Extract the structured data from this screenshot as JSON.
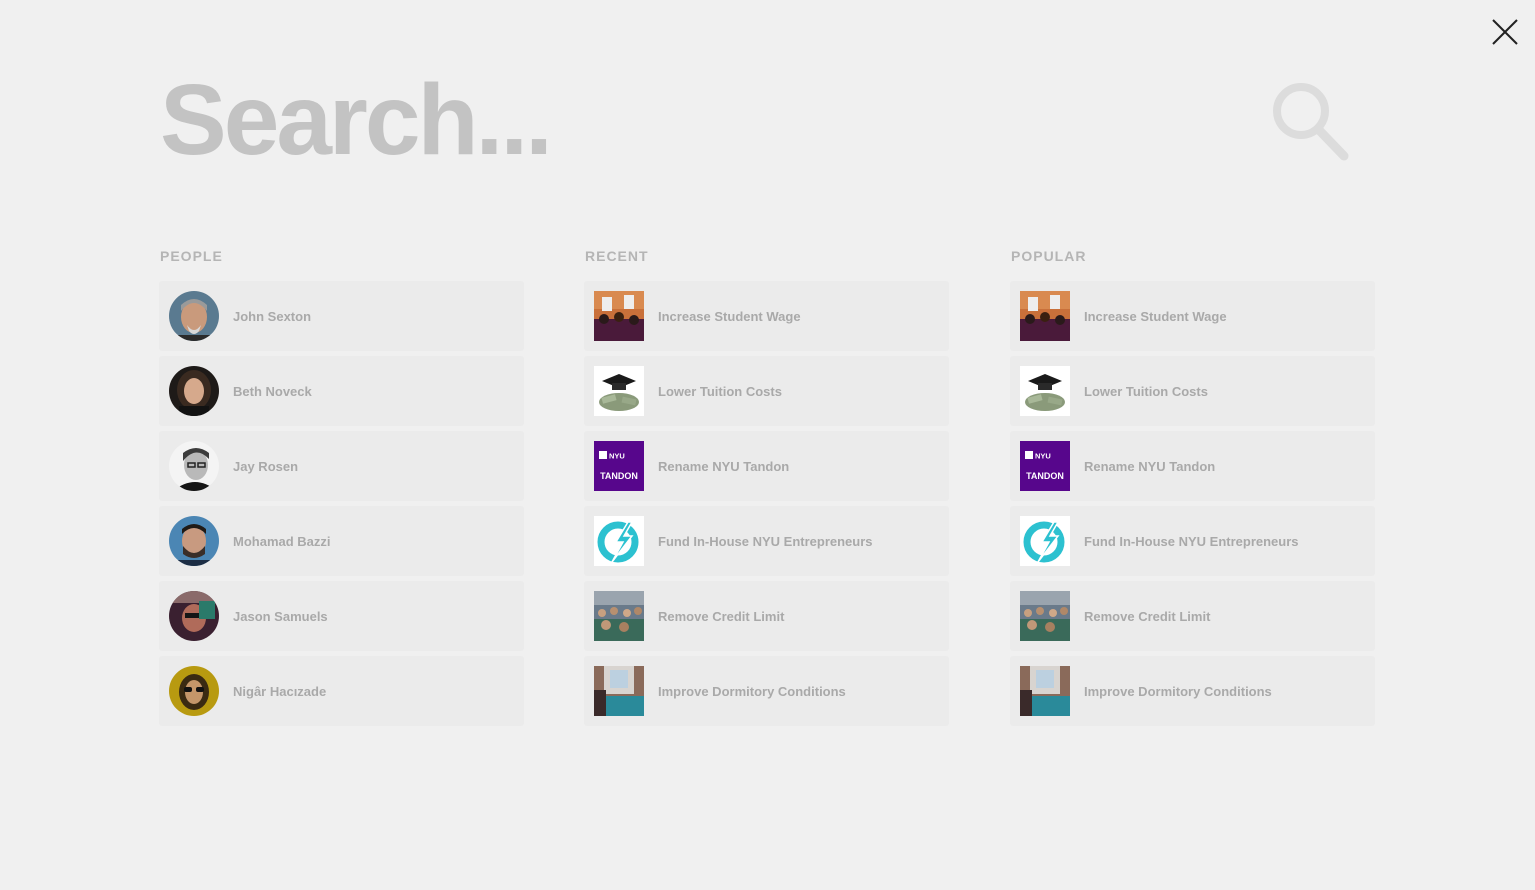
{
  "search": {
    "placeholder": "Search..."
  },
  "sections": {
    "people": {
      "title": "PEOPLE",
      "items": [
        {
          "name": "John Sexton"
        },
        {
          "name": "Beth Noveck"
        },
        {
          "name": "Jay Rosen"
        },
        {
          "name": "Mohamad Bazzi"
        },
        {
          "name": "Jason Samuels"
        },
        {
          "name": "Nigâr Hacızade"
        }
      ]
    },
    "recent": {
      "title": "RECENT",
      "items": [
        {
          "label": "Increase Student Wage"
        },
        {
          "label": "Lower Tuition Costs"
        },
        {
          "label": "Rename NYU Tandon"
        },
        {
          "label": "Fund In-House NYU Entrepreneurs"
        },
        {
          "label": "Remove Credit Limit"
        },
        {
          "label": "Improve Dormitory Conditions"
        }
      ]
    },
    "popular": {
      "title": "POPULAR",
      "items": [
        {
          "label": "Increase Student Wage"
        },
        {
          "label": "Lower Tuition Costs"
        },
        {
          "label": "Rename NYU Tandon"
        },
        {
          "label": "Fund In-House NYU Entrepreneurs"
        },
        {
          "label": "Remove Credit Limit"
        },
        {
          "label": "Improve Dormitory Conditions"
        }
      ]
    }
  },
  "tandon_logo": {
    "line1": "NYU",
    "line2": "TANDON"
  },
  "icons": {
    "close": "close-icon",
    "search": "search-icon"
  },
  "colors": {
    "background": "#f0f0f0",
    "card": "#ebebeb",
    "text": "#a9a9a9",
    "heading": "#b5b5b5",
    "tandon_purple": "#57068c"
  }
}
